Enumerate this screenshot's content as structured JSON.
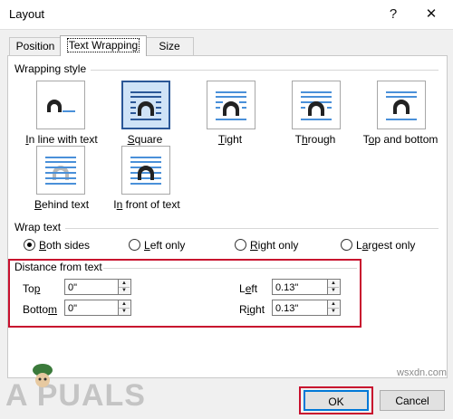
{
  "window": {
    "title": "Layout",
    "help_glyph": "?",
    "close_glyph": "✕"
  },
  "tabs": [
    {
      "label": "Position",
      "active": false
    },
    {
      "label": "Text Wrapping",
      "active": true
    },
    {
      "label": "Size",
      "active": false
    }
  ],
  "wrapping_style": {
    "label": "Wrapping style",
    "options": [
      {
        "label": "In line with text",
        "icon": "inline-wrap-icon",
        "selected": false
      },
      {
        "label": "Square",
        "icon": "square-wrap-icon",
        "selected": true
      },
      {
        "label": "Tight",
        "icon": "tight-wrap-icon",
        "selected": false
      },
      {
        "label": "Through",
        "icon": "through-wrap-icon",
        "selected": false
      },
      {
        "label": "Top and bottom",
        "icon": "top-bottom-wrap-icon",
        "selected": false
      },
      {
        "label": "Behind text",
        "icon": "behind-text-icon",
        "selected": false
      },
      {
        "label": "In front of text",
        "icon": "in-front-text-icon",
        "selected": false
      }
    ]
  },
  "wrap_text": {
    "label": "Wrap text",
    "options": [
      {
        "label": "Both sides",
        "selected": true
      },
      {
        "label": "Left only",
        "selected": false
      },
      {
        "label": "Right only",
        "selected": false
      },
      {
        "label": "Largest only",
        "selected": false
      }
    ]
  },
  "distance": {
    "label": "Distance from text",
    "top": {
      "label": "Top",
      "value": "0\""
    },
    "bottom": {
      "label": "Bottom",
      "value": "0\""
    },
    "left": {
      "label": "Left",
      "value": "0.13\""
    },
    "right": {
      "label": "Right",
      "value": "0.13\""
    }
  },
  "buttons": {
    "ok": "OK",
    "cancel": "Cancel"
  },
  "watermark": {
    "brand": "A  PUALS",
    "site": "wsxdn.com"
  },
  "colors": {
    "highlight_red": "#c8102e",
    "selected_blue": "#2b5797",
    "focus_blue": "#0078d7"
  }
}
